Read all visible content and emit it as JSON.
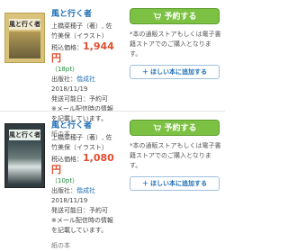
{
  "items": [
    {
      "cover_title": "風と行く者",
      "title": "風と行く者",
      "author": "上橋菜穂子（著）, 佐竹美保（イラスト）",
      "price_label": "税込価格：",
      "price": "1,944円",
      "points": "（18pt）",
      "publisher_label": "出版社：",
      "publisher": "偕成社",
      "date": "2018/11/19",
      "release_label": "発送可能日：予約可",
      "mail_note": "※メール配信時の情報を記載しています。",
      "format": "紙の本",
      "buy_label": "予約する",
      "notice": "*本の通販ストアもしくは電子書籍ストアでのご購入となります。",
      "wish_label": "ほしい本に追加する"
    },
    {
      "cover_title": "風と行く者",
      "title": "風と行く者",
      "author": "上橋菜穂子（著）, 佐竹美保（イラスト）",
      "price_label": "税込価格：",
      "price": "1,080円",
      "points": "（10pt）",
      "publisher_label": "出版社：",
      "publisher": "偕成社",
      "date": "2018/11/19",
      "release_label": "発送可能日：予約可",
      "mail_note": "※メール配信時の情報を記載しています。",
      "format": "紙の本",
      "buy_label": "予約する",
      "notice": "*本の通販ストアもしくは電子書籍ストアでのご購入となります。",
      "wish_label": "ほしい本に追加する"
    }
  ],
  "colors": {
    "buy_button": "#7cc143",
    "price": "#e04d2f",
    "link": "#1f6fb5"
  },
  "icons": {
    "buy": "cart-icon",
    "wish": "plus-icon"
  }
}
